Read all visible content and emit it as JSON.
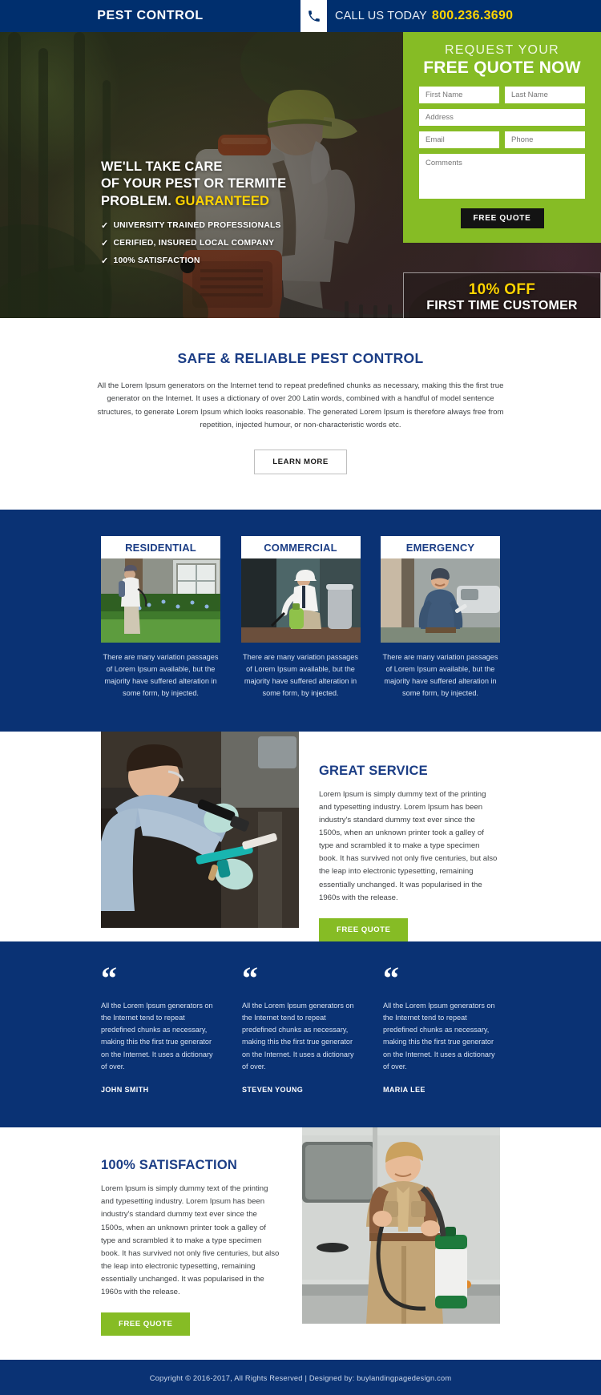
{
  "topbar": {
    "brand": "PEST CONTROL",
    "phone_icon": "phone-icon",
    "call_label": "CALL US TODAY",
    "phone_number": "800.236.3690",
    "bg_color": "#002f6e",
    "number_color": "#ffd400"
  },
  "hero": {
    "headline_line1": "WE'LL TAKE CARE",
    "headline_line2": "OF YOUR PEST OR TERMITE",
    "headline_line3": "PROBLEM.",
    "headline_highlight": "GUARANTEED",
    "bullets": [
      "UNIVERSITY TRAINED PROFESSIONALS",
      "CERIFIED, INSURED LOCAL COMPANY",
      "100% SATISFACTION"
    ],
    "check_icon": "check-icon",
    "image_alt": "pest-control-worker-with-backpack-sprayer"
  },
  "form": {
    "title_top": "REQUEST YOUR",
    "title_main": "FREE QUOTE NOW",
    "first_name_placeholder": "First Name",
    "last_name_placeholder": "Last Name",
    "address_placeholder": "Address",
    "email_placeholder": "Email",
    "phone_placeholder": "Phone",
    "comments_placeholder": "Comments",
    "first_name_value": "",
    "last_name_value": "",
    "address_value": "",
    "email_value": "",
    "phone_value": "",
    "comments_value": "",
    "submit_label": "FREE QUOTE",
    "bg_color": "#86bc25"
  },
  "offer": {
    "discount": "10% OFF",
    "subtitle": "FIRST TIME CUSTOMER"
  },
  "intro": {
    "heading": "SAFE & RELIABLE PEST CONTROL",
    "body": "All the Lorem Ipsum generators on the Internet tend to repeat predefined chunks as necessary, making this the first true generator on the Internet. It uses a dictionary of over 200 Latin words, combined with a handful of model sentence structures, to generate Lorem Ipsum which looks reasonable. The generated Lorem Ipsum is therefore always free from repetition, injected humour, or non-characteristic words etc.",
    "button_label": "LEARN MORE"
  },
  "services": {
    "bg_color": "#0a3274",
    "cards": [
      {
        "title": "RESIDENTIAL",
        "desc": "There are many variation passages of Lorem Ipsum available, but the majority have suffered alteration in some form, by injected.",
        "image_alt": "technician-spraying-outside-house"
      },
      {
        "title": "COMMERCIAL",
        "desc": "There are many variation passages of Lorem Ipsum available, but the majority have suffered alteration in some form, by injected.",
        "image_alt": "technician-spraying-indoor-baseboard"
      },
      {
        "title": "EMERGENCY",
        "desc": "There are many variation passages of Lorem Ipsum available, but the majority have suffered alteration in some form, by injected.",
        "image_alt": "smiling-technician-with-clipboard"
      }
    ]
  },
  "great_service": {
    "heading": "GREAT SERVICE",
    "body": "Lorem Ipsum is simply dummy text of the printing and typesetting industry. Lorem Ipsum has been industry's standard dummy text ever since the 1500s, when an unknown printer took a galley of type and scrambled it to make a type specimen book. It has survived not only five centuries, but also the leap into electronic typesetting, remaining essentially unchanged. It was popularised in the 1960s with the release.",
    "button_label": "FREE QUOTE",
    "image_alt": "technician-inspecting-with-flashlight"
  },
  "testimonials": {
    "quote_icon": "quote-icon",
    "items": [
      {
        "text": "All the Lorem Ipsum generators on the Internet tend to repeat predefined chunks as necessary, making this the first true generator on the Internet. It uses a dictionary of over.",
        "author": "JOHN SMITH"
      },
      {
        "text": "All the Lorem Ipsum generators on the Internet tend to repeat predefined chunks as necessary, making this the first true generator on the Internet. It uses a dictionary of over.",
        "author": "STEVEN YOUNG"
      },
      {
        "text": "All the Lorem Ipsum generators on the Internet tend to repeat predefined chunks as necessary, making this the first true generator on the Internet. It uses a dictionary of over.",
        "author": "MARIA LEE"
      }
    ]
  },
  "satisfaction": {
    "heading": "100% SATISFACTION",
    "body": "Lorem Ipsum is simply dummy text of the printing and typesetting industry. Lorem Ipsum has been industry's standard dummy text ever since the 1500s, when an unknown printer took a galley of type and scrambled it to make a type specimen book. It has survived not only five centuries, but also the leap into electronic typesetting, remaining essentially unchanged. It was popularised in the 1960s with the release.",
    "button_label": "FREE QUOTE",
    "image_alt": "technician-with-sprayer-next-to-van"
  },
  "footer": {
    "text": "Copyright © 2016-2017, All Rights Reserved  |  Designed by: buylandingpagedesign.com"
  }
}
